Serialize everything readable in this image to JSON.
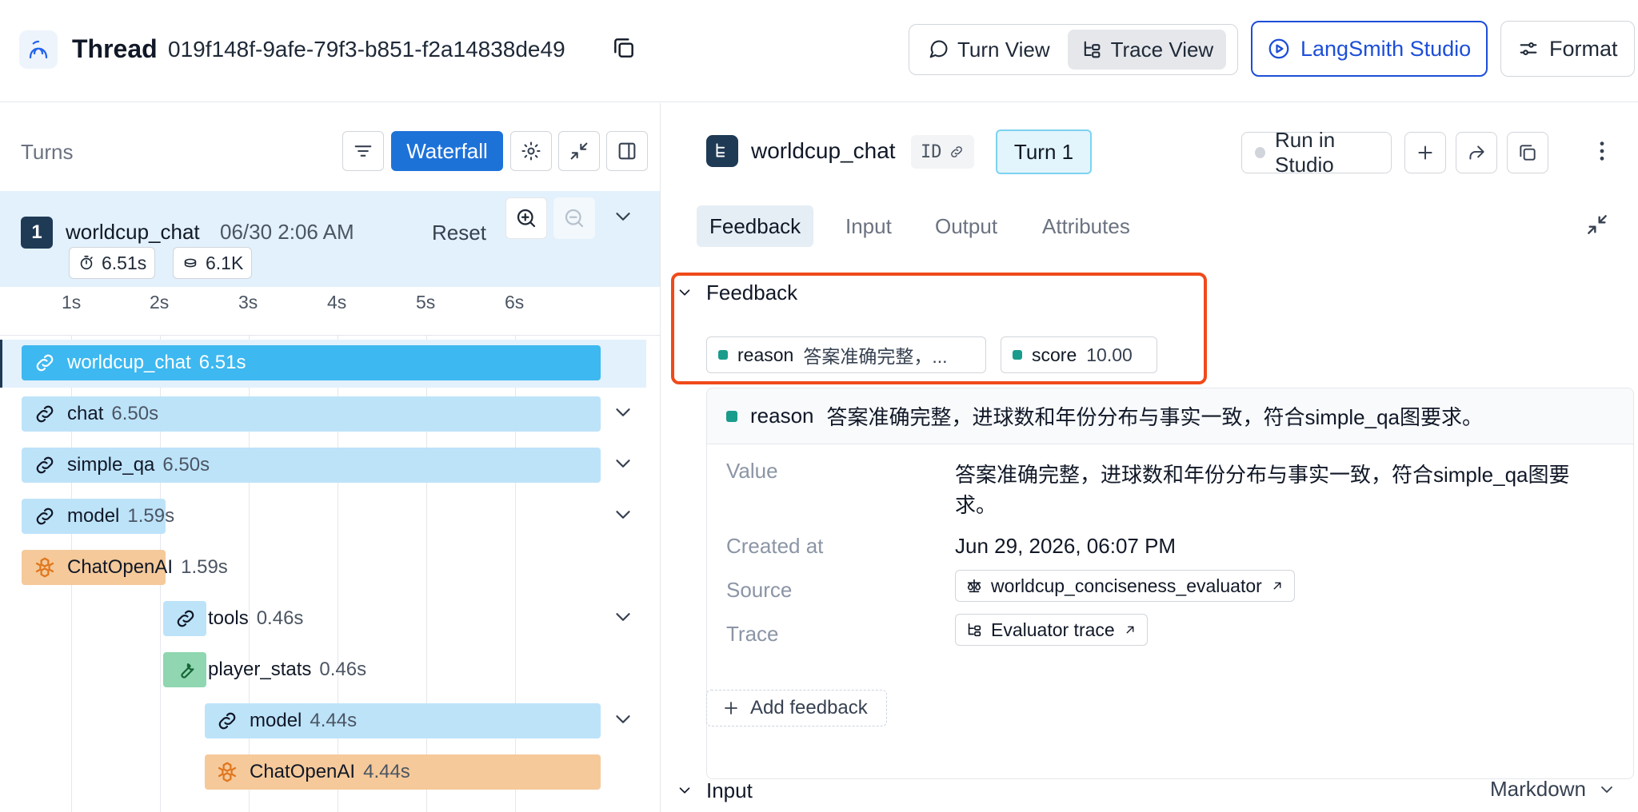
{
  "header": {
    "title": "Thread",
    "thread_id": "019f148f-9afe-79f3-b851-f2a14838de49",
    "views": [
      "Turn View",
      "Trace View"
    ],
    "active_view": "Trace View",
    "studio_label": "LangSmith Studio",
    "format_label": "Format"
  },
  "left": {
    "turns_label": "Turns",
    "waterfall_label": "Waterfall",
    "turn": {
      "number": "1",
      "name": "worldcup_chat",
      "date": "06/30 2:06 AM",
      "reset_label": "Reset",
      "duration": "6.51s",
      "tokens": "6.1K"
    },
    "axis_ticks": [
      "1s",
      "2s",
      "3s",
      "4s",
      "5s",
      "6s"
    ],
    "spans": [
      {
        "name": "worldcup_chat",
        "duration": "6.51s",
        "kind": "chain",
        "selected": true
      },
      {
        "name": "chat",
        "duration": "6.50s",
        "kind": "chain"
      },
      {
        "name": "simple_qa",
        "duration": "6.50s",
        "kind": "chain"
      },
      {
        "name": "model",
        "duration": "1.59s",
        "kind": "chain"
      },
      {
        "name": "ChatOpenAI",
        "duration": "1.59s",
        "kind": "llm"
      },
      {
        "name": "tools",
        "duration": "0.46s",
        "kind": "chain"
      },
      {
        "name": "player_stats",
        "duration": "0.46s",
        "kind": "tool"
      },
      {
        "name": "model",
        "duration": "4.44s",
        "kind": "chain"
      },
      {
        "name": "ChatOpenAI",
        "duration": "4.44s",
        "kind": "llm"
      }
    ]
  },
  "right": {
    "run_name": "worldcup_chat",
    "id_label": "ID",
    "turn_label": "Turn 1",
    "run_in_studio": "Run in Studio",
    "tabs": [
      "Feedback",
      "Input",
      "Output",
      "Attributes"
    ],
    "active_tab": "Feedback",
    "feedback_section": "Feedback",
    "chips": [
      {
        "key": "reason",
        "value": "答案准确完整，..."
      },
      {
        "key": "score",
        "value": "10.00"
      }
    ],
    "detail": {
      "key": "reason",
      "summary": "答案准确完整，进球数和年份分布与事实一致，符合simple_qa图要求。",
      "value_label": "Value",
      "value_line1": "答案准确完整，进球数和年份分布与事实一致，符合simple_qa图要",
      "value_line2": "求。",
      "created_label": "Created at",
      "created_value": "Jun 29, 2026, 06:07 PM",
      "source_label": "Source",
      "source_value": "worldcup_conciseness_evaluator",
      "trace_label": "Trace",
      "trace_value": "Evaluator trace"
    },
    "add_feedback": "Add feedback",
    "input_section": "Input",
    "markdown_label": "Markdown"
  },
  "colors": {
    "accent": "#1d72d8",
    "highlight": "#f04a1a",
    "teal": "#1a9c8c",
    "span_blue": "#bde3f9",
    "span_selected": "#3db8f0",
    "span_orange": "#f5c99a",
    "span_green": "#8fd6b1"
  }
}
